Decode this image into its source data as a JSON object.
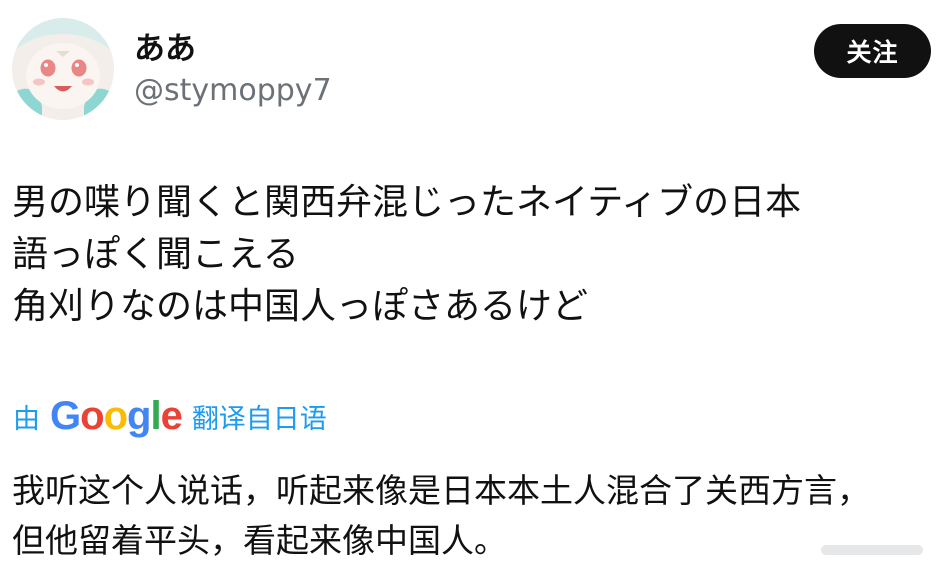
{
  "author": {
    "display_name": "ああ",
    "handle": "@stymoppy7",
    "avatar_icon": "anime-girl-avatar"
  },
  "follow_button": {
    "label": "关注"
  },
  "post": {
    "lines": [
      "男の喋り聞くと関西弁混じったネイティブの日本",
      "語っぽく聞こえる",
      "角刈りなのは中国人っぽさあるけど"
    ]
  },
  "translation": {
    "by_label": "由",
    "provider_letters": [
      "G",
      "o",
      "o",
      "g",
      "l",
      "e"
    ],
    "source_label": "翻译自日语",
    "lines": [
      "我听这个人说话，听起来像是日本本土人混合了关西方言，",
      "但他留着平头，看起来像中国人。"
    ]
  },
  "colors": {
    "link_blue": "#1d9bf0",
    "follow_bg": "#111111",
    "handle_gray": "#6b7177",
    "google_blue": "#4285f4",
    "google_red": "#ea4335",
    "google_yellow": "#fbbc05",
    "google_green": "#34a853"
  }
}
